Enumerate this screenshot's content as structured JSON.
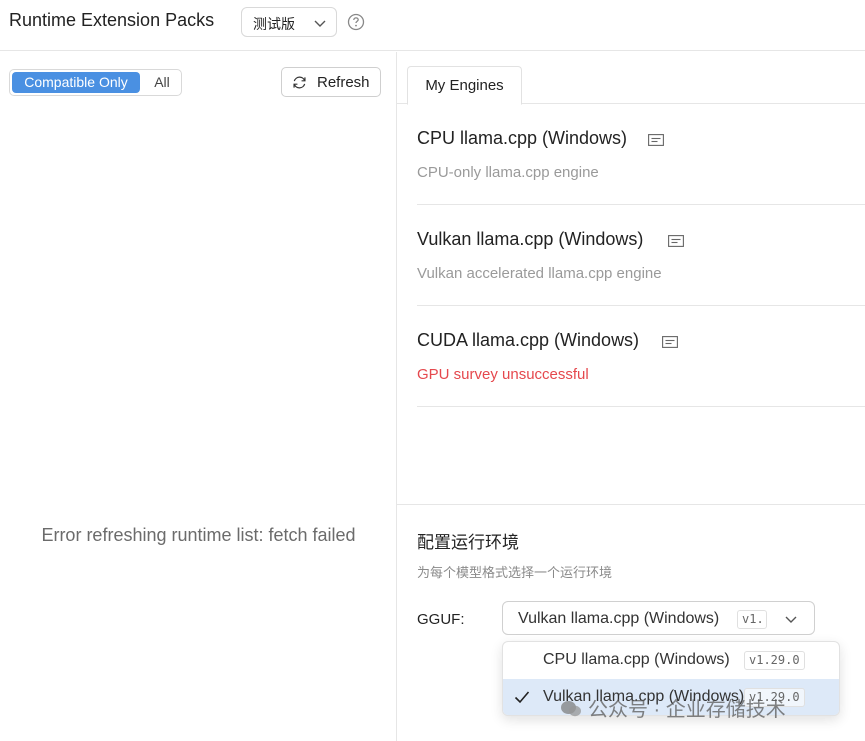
{
  "header": {
    "title": "Runtime Extension Packs",
    "channel_select": {
      "value": "测试版",
      "icon": "chevron-down-icon"
    },
    "help_icon": "question-circle-icon"
  },
  "left": {
    "filter": {
      "compatible_only": "Compatible Only",
      "all": "All",
      "selected": "Compatible Only"
    },
    "refresh_button": {
      "label": "Refresh",
      "icon": "refresh-icon"
    },
    "error": "Error refreshing runtime list: fetch failed"
  },
  "right": {
    "tabs": [
      {
        "label": "My Engines",
        "active": true
      }
    ],
    "engines": [
      {
        "name": "CPU llama.cpp (Windows)",
        "description": "CPU-only llama.cpp engine",
        "status": "normal"
      },
      {
        "name": "Vulkan llama.cpp (Windows)",
        "description": "Vulkan accelerated llama.cpp engine",
        "status": "normal"
      },
      {
        "name": "CUDA llama.cpp (Windows)",
        "description": "GPU survey unsuccessful",
        "status": "error"
      }
    ],
    "config": {
      "title": "配置运行环境",
      "subtitle": "为每个模型格式选择一个运行环境",
      "format_label": "GGUF:",
      "selected_runtime": "Vulkan llama.cpp (Windows)",
      "selected_version": "v1.",
      "options": [
        {
          "label": "CPU llama.cpp (Windows)",
          "version": "v1.29.0",
          "selected": false
        },
        {
          "label": "Vulkan llama.cpp (Windows)",
          "version": "v1.29.0",
          "selected": true
        }
      ]
    }
  },
  "watermark": "公众号 · 企业存储技术",
  "colors": {
    "accent": "#4a90e2",
    "error": "#e5484d",
    "selected_row": "#dde9f8"
  }
}
